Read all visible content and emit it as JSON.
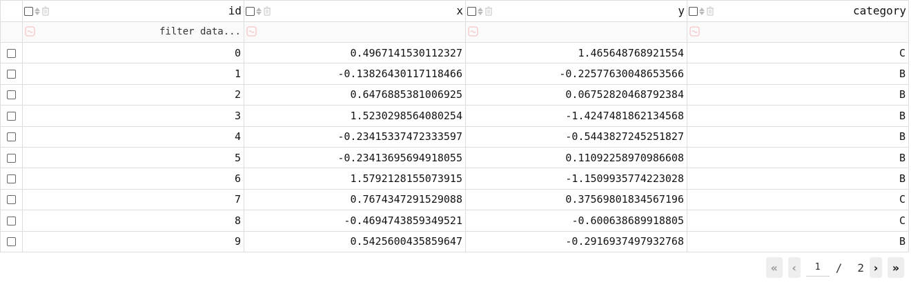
{
  "table": {
    "columns": [
      {
        "key": "id",
        "label": "id"
      },
      {
        "key": "x",
        "label": "x"
      },
      {
        "key": "y",
        "label": "y"
      },
      {
        "key": "category",
        "label": "category"
      }
    ],
    "filter_placeholder": "filter data...",
    "rows": [
      {
        "id": "0",
        "x": "0.4967141530112327",
        "y": "1.465648768921554",
        "category": "C"
      },
      {
        "id": "1",
        "x": "-0.13826430117118466",
        "y": "-0.22577630048653566",
        "category": "B"
      },
      {
        "id": "2",
        "x": "0.6476885381006925",
        "y": "0.06752820468792384",
        "category": "B"
      },
      {
        "id": "3",
        "x": "1.5230298564080254",
        "y": "-1.4247481862134568",
        "category": "B"
      },
      {
        "id": "4",
        "x": "-0.23415337472333597",
        "y": "-0.5443827245251827",
        "category": "B"
      },
      {
        "id": "5",
        "x": "-0.23413695694918055",
        "y": "0.11092258970986608",
        "category": "B"
      },
      {
        "id": "6",
        "x": "1.5792128155073915",
        "y": "-1.1509935774223028",
        "category": "B"
      },
      {
        "id": "7",
        "x": "0.7674347291529088",
        "y": "0.37569801834567196",
        "category": "C"
      },
      {
        "id": "8",
        "x": "-0.4694743859349521",
        "y": "-0.600638689918805",
        "category": "C"
      },
      {
        "id": "9",
        "x": "0.5425600435859647",
        "y": "-0.2916937497932768",
        "category": "B"
      }
    ]
  },
  "pager": {
    "first": "«",
    "prev": "‹",
    "current_page": "1",
    "separator": "/",
    "total_pages": "2",
    "next": "›",
    "last": "»"
  },
  "icons": {
    "sort": "sort-icon",
    "trash": "trash-icon",
    "filter": "filter-icon"
  },
  "colors": {
    "border": "#dddddd",
    "muted_icon": "#bbbbbb",
    "filter_icon": "#f3c6c6"
  }
}
